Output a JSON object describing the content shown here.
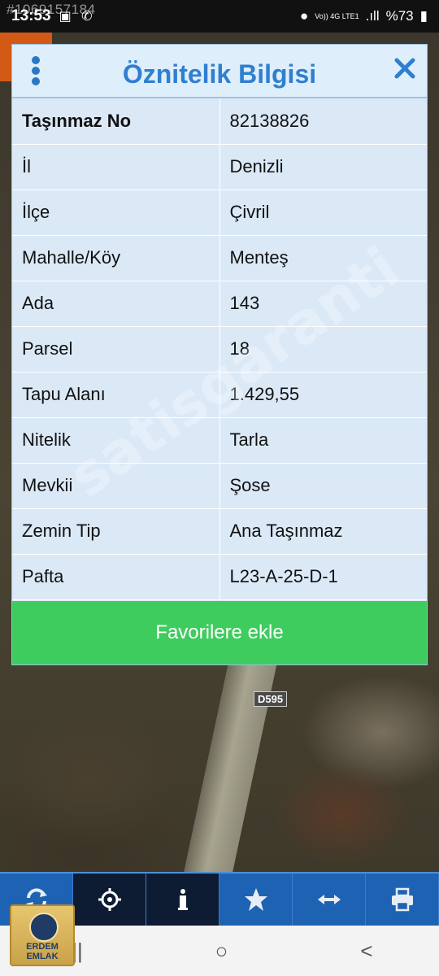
{
  "status_bar": {
    "time": "13:53",
    "watermark_id": "#1069157184",
    "network": "Vo)) 4G LTE1",
    "battery": "%73"
  },
  "dialog": {
    "title": "Öznitelik Bilgisi",
    "rows": [
      {
        "key": "Taşınmaz No",
        "value": "82138826"
      },
      {
        "key": "İl",
        "value": "Denizli"
      },
      {
        "key": "İlçe",
        "value": "Çivril"
      },
      {
        "key": "Mahalle/Köy",
        "value": "Menteş"
      },
      {
        "key": "Ada",
        "value": "143"
      },
      {
        "key": "Parsel",
        "value": "18"
      },
      {
        "key": "Tapu Alanı",
        "value": "1.429,55"
      },
      {
        "key": "Nitelik",
        "value": "Tarla"
      },
      {
        "key": "Mevkii",
        "value": "Şose"
      },
      {
        "key": "Zemin Tip",
        "value": "Ana Taşınmaz"
      },
      {
        "key": "Pafta",
        "value": "L23-A-25-D-1"
      }
    ],
    "favorite_button": "Favorilere ekle"
  },
  "watermark": "satisgaranti",
  "map": {
    "road_label": "D595"
  },
  "toolbar": {
    "items": [
      "refresh-icon",
      "locate-icon",
      "info-icon",
      "star-icon",
      "measure-icon",
      "print-icon"
    ]
  },
  "logo": {
    "text": "ERDEM EMLAK"
  },
  "nav_bar": {
    "recents": "|||",
    "home": "○",
    "back": "<"
  },
  "colors": {
    "title": "#2f7fd0",
    "button": "#3fcc5e",
    "toolbar": "#1e63b3"
  }
}
